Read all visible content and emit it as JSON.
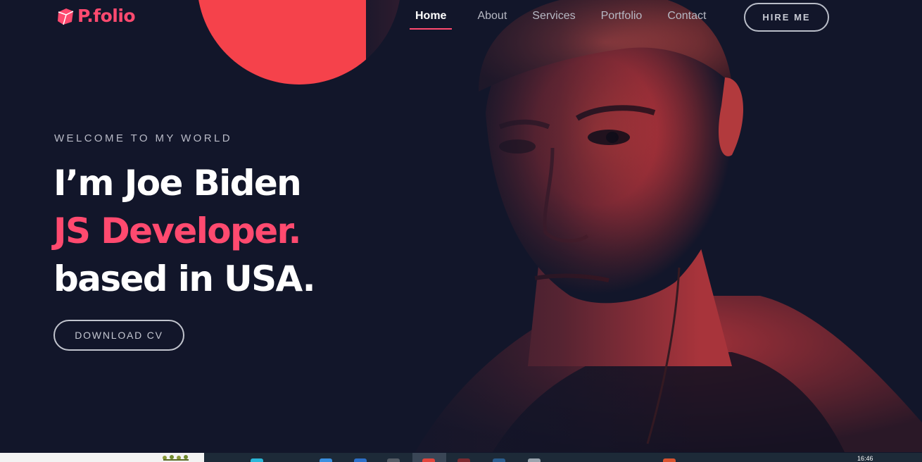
{
  "header": {
    "logo_text": "P.folio",
    "nav": [
      {
        "label": "Home",
        "active": true
      },
      {
        "label": "About",
        "active": false
      },
      {
        "label": "Services",
        "active": false
      },
      {
        "label": "Portfolio",
        "active": false
      },
      {
        "label": "Contact",
        "active": false
      }
    ],
    "hire_button": "HIRE ME"
  },
  "hero": {
    "welcome": "WELCOME TO MY WORLD",
    "line1": "I’m Joe Biden",
    "line2": "JS Developer.",
    "line3": "based in USA.",
    "cv_button": "DOWNLOAD CV"
  },
  "taskbar": {
    "clock": "16:46"
  },
  "colors": {
    "background": "#12162a",
    "accent": "#ff4a6f",
    "circle": "#f5424b"
  }
}
